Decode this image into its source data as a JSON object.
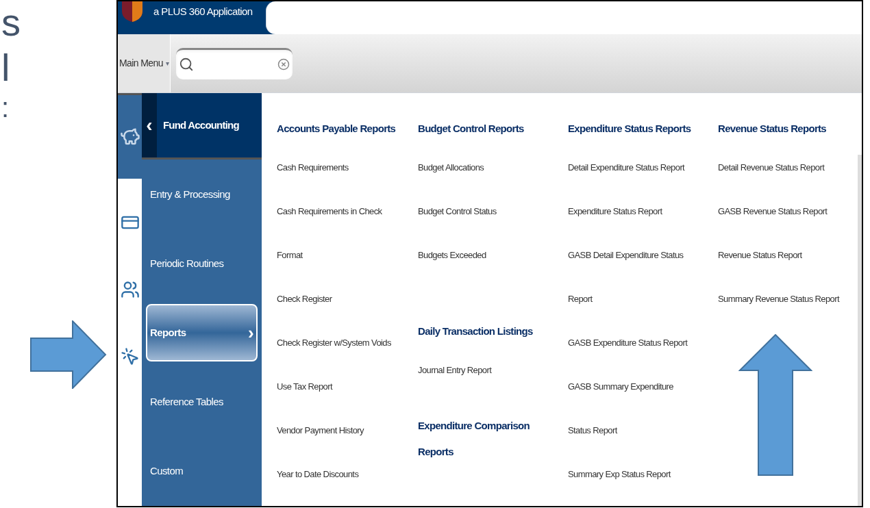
{
  "slide_fragments": [
    "s",
    "l",
    ":"
  ],
  "app": {
    "title": "a PLUS 360 Application",
    "main_menu": "Main Menu",
    "main_menu_caret": "▾"
  },
  "nav": {
    "header": "Fund Accounting",
    "back_glyph": "‹",
    "items": [
      {
        "label": "Entry & Processing",
        "selected": false
      },
      {
        "label": "Periodic Routines",
        "selected": false
      },
      {
        "label": "Reports",
        "selected": true
      },
      {
        "label": "Reference Tables",
        "selected": false
      },
      {
        "label": "Custom",
        "selected": false
      }
    ],
    "chevron": "›"
  },
  "columns": [
    {
      "sections": [
        {
          "heading": "Accounts Payable Reports",
          "items": [
            "Cash Requirements",
            "Cash Requirements in Check",
            "Format",
            "Check Register",
            "Check Register w/System Voids",
            "Use Tax Report",
            "Vendor Payment History",
            "Year to Date Discounts"
          ]
        }
      ]
    },
    {
      "sections": [
        {
          "heading": "Budget Control Reports",
          "items": [
            "Budget Allocations",
            "Budget Control Status",
            "Budgets Exceeded"
          ]
        },
        {
          "heading": "Daily Transaction Listings",
          "items": [
            "Journal Entry Report"
          ]
        },
        {
          "heading": "Expenditure Comparison Reports"
        }
      ]
    },
    {
      "sections": [
        {
          "heading": "Expenditure Status Reports",
          "items": [
            "Detail Expenditure Status Report",
            "Expenditure Status Report",
            "GASB Detail Expenditure Status Report",
            "GASB Expenditure Status Report",
            "GASB Summary Expenditure Status Report",
            "Summary Exp Status Report"
          ]
        }
      ]
    },
    {
      "sections": [
        {
          "heading": "Revenue Status Reports",
          "items": [
            "Detail Revenue Status Report",
            "GASB Revenue Status Report",
            "Revenue Status Report",
            "Summary Revenue Status Report"
          ]
        }
      ]
    }
  ]
}
